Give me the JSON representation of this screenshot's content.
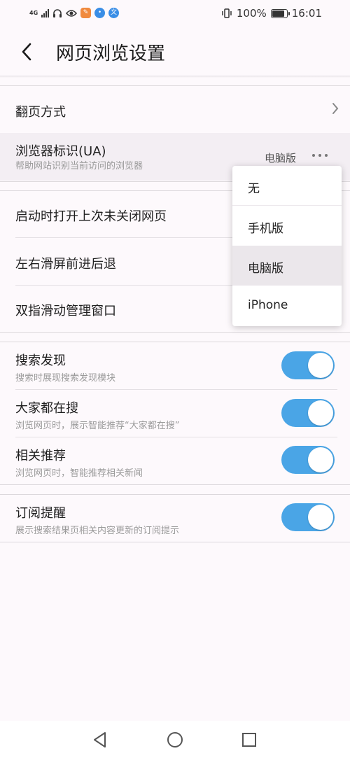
{
  "status_bar": {
    "network": "4G",
    "battery": "100%",
    "time": "16:01",
    "icons": [
      "signal-icon",
      "headset-icon",
      "eye-icon",
      "app-icon",
      "baidu-icon",
      "translate-icon",
      "vibrate-icon",
      "battery-icon"
    ]
  },
  "header": {
    "title": "网页浏览设置",
    "back_icon": "back-arrow-icon"
  },
  "section1": {
    "page_turn": {
      "label": "翻页方式"
    },
    "ua": {
      "label": "浏览器标识(UA)",
      "sub": "帮助网站识别当前访问的浏览器",
      "value": "电脑版"
    }
  },
  "section2": {
    "items": [
      {
        "label": "启动时打开上次未关闭网页"
      },
      {
        "label": "左右滑屏前进后退"
      },
      {
        "label": "双指滑动管理窗口"
      }
    ]
  },
  "section3": {
    "items": [
      {
        "label": "搜索发现",
        "sub": "搜索时展现搜索发现模块",
        "on": true
      },
      {
        "label": "大家都在搜",
        "sub": "浏览网页时，展示智能推荐“大家都在搜”",
        "on": true
      },
      {
        "label": "相关推荐",
        "sub": "浏览网页时，智能推荐相关新闻",
        "on": true
      }
    ]
  },
  "section4": {
    "items": [
      {
        "label": "订阅提醒",
        "sub": "展示搜索结果页相关内容更新的订阅提示",
        "on": true
      }
    ]
  },
  "ua_menu": {
    "options": [
      "无",
      "手机版",
      "电脑版",
      "iPhone"
    ],
    "selected": "电脑版"
  },
  "colors": {
    "toggle_on": "#4aa5e6",
    "background": "#fdf9fc",
    "selected_bg": "#ebe7eb"
  },
  "nav_bar": {
    "icons": [
      "back-triangle-icon",
      "home-circle-icon",
      "recents-square-icon"
    ]
  }
}
